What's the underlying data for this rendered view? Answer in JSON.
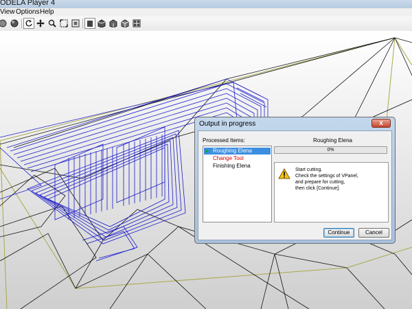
{
  "window": {
    "title": "ODELA Player 4"
  },
  "menu": [
    "View",
    "Options",
    "Help"
  ],
  "toolbar": {
    "icons": [
      "rotate-icon",
      "pan-icon",
      "zoom-icon",
      "zoom-window-icon",
      "fit-view-icon",
      "view-front-icon",
      "view-top-icon",
      "view-right-icon",
      "view-iso-icon",
      "view-multi-icon"
    ]
  },
  "dialog": {
    "title": "Output in progress",
    "close_glyph": "x",
    "processed_label": "Processed Items:",
    "items": [
      {
        "label": "Roughing Elena",
        "state": "selected"
      },
      {
        "label": "Change Tool",
        "state": "red"
      },
      {
        "label": "Finishing Elena",
        "state": "normal"
      }
    ],
    "current_item": "Roughing Elena",
    "progress_value": 0,
    "progress_text": "0%",
    "message_lines": [
      "Start cutting.",
      "Check the settings of VPanel,",
      "and prepare for cutting,",
      "then click [Continue]."
    ],
    "continue_label": "Continue",
    "cancel_label": "Cancel"
  },
  "colors": {
    "progress_fill": "#55c455",
    "selection": "#3b8fe0",
    "toolpath": "#1a1acc",
    "mesh": "#000000",
    "outline": "#a8a84a"
  }
}
